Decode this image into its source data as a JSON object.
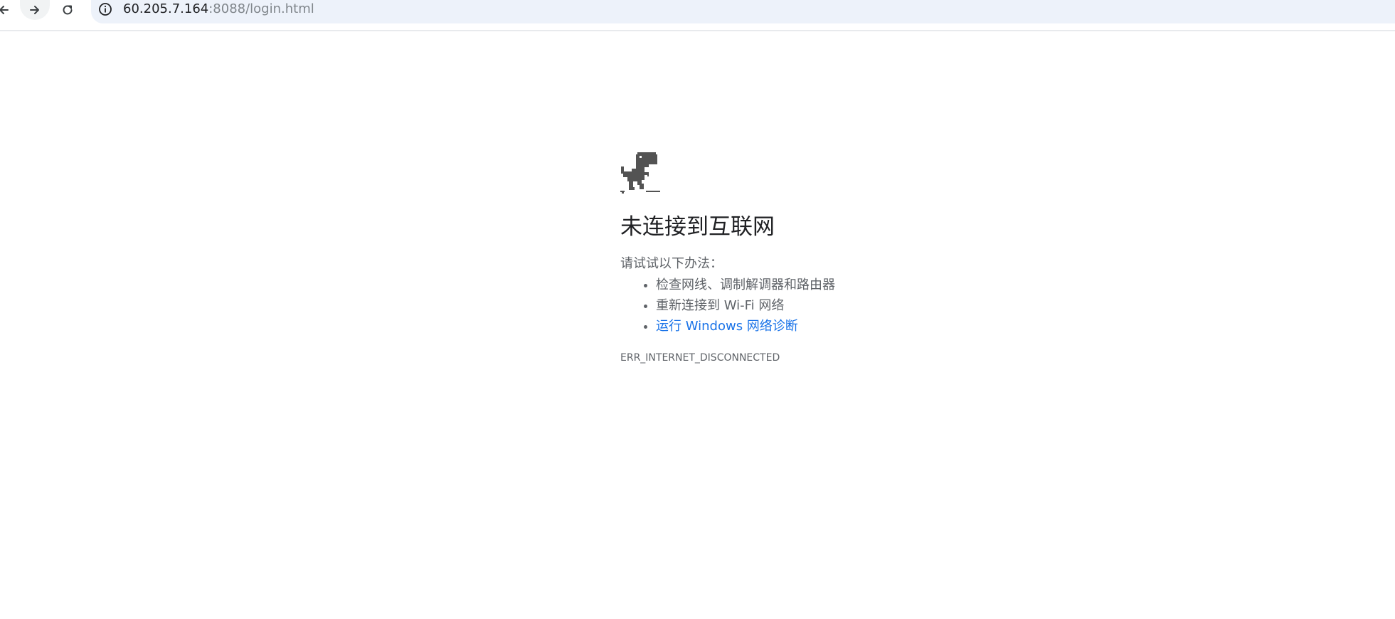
{
  "browser": {
    "url_host": "60.205.7.164",
    "url_rest": ":8088/login.html",
    "back_icon": "arrow-left-icon",
    "forward_icon": "arrow-right-icon",
    "reload_icon": "reload-icon",
    "site_info_icon": "info-icon"
  },
  "error_page": {
    "illustration": "dino-icon",
    "title": "未连接到互联网",
    "try_text": "请试试以下办法：",
    "suggestions": [
      "检查网线、调制解调器和路由器",
      "重新连接到 Wi-Fi 网络",
      "运行 Windows 网络诊断"
    ],
    "error_code": "ERR_INTERNET_DISCONNECTED"
  },
  "colors": {
    "link": "#1a73e8",
    "secondary_text": "#5f6368",
    "omnibox_bg": "#edf2fa"
  }
}
